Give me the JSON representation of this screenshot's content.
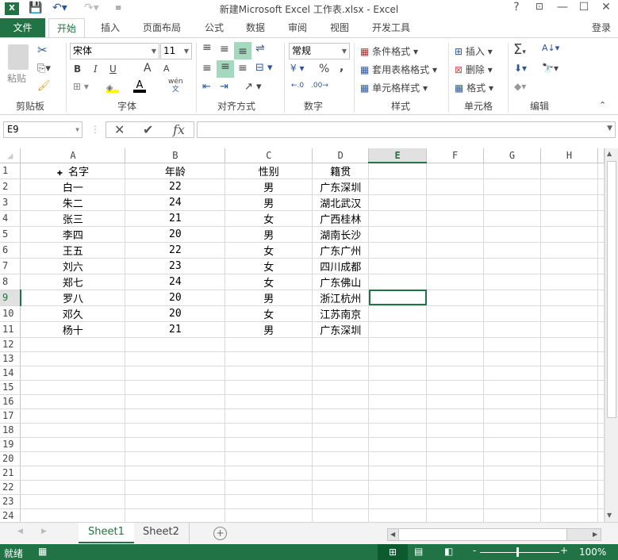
{
  "title": "新建Microsoft Excel 工作表.xlsx - Excel",
  "window_controls": {
    "help": "?",
    "restore_ribbon": "⊡",
    "minimize": "—",
    "maximize": "☐",
    "close": "✕"
  },
  "tabs": [
    "文件",
    "开始",
    "插入",
    "页面布局",
    "公式",
    "数据",
    "审阅",
    "视图",
    "开发工具"
  ],
  "login": "登录",
  "ribbon": {
    "clipboard": {
      "paste": "粘贴",
      "label": "剪贴板"
    },
    "font": {
      "name": "宋体",
      "size": "11",
      "bold": "B",
      "italic": "I",
      "underline": "U",
      "grow": "A",
      "shrink": "A",
      "wen": "wén",
      "wen2": "文",
      "label": "字体",
      "font_color": "#c00000",
      "fill_color": "#ffff00"
    },
    "alignment": {
      "label": "对齐方式"
    },
    "number": {
      "format": "常规",
      "percent": "%",
      "comma": ",",
      "label": "数字"
    },
    "styles": {
      "conditional": "条件格式",
      "table": "套用表格格式",
      "cell": "单元格样式",
      "label": "样式"
    },
    "cells": {
      "insert": "插入",
      "delete": "删除",
      "format": "格式",
      "label": "单元格"
    },
    "editing": {
      "label": "编辑"
    }
  },
  "formula_bar": {
    "name_box": "E9",
    "cancel": "✕",
    "enter": "✔",
    "fx": "fx",
    "value": ""
  },
  "columns": [
    "A",
    "B",
    "C",
    "D",
    "E",
    "F",
    "G",
    "H"
  ],
  "selected_col": "E",
  "selected_row": 9,
  "rows": [
    [
      "名字",
      "年龄",
      "性别",
      "籍贯"
    ],
    [
      "白一",
      "22",
      "男",
      "广东深圳"
    ],
    [
      "朱二",
      "24",
      "男",
      "湖北武汉"
    ],
    [
      "张三",
      "21",
      "女",
      "广西桂林"
    ],
    [
      "李四",
      "20",
      "男",
      "湖南长沙"
    ],
    [
      "王五",
      "22",
      "女",
      "广东广州"
    ],
    [
      "刘六",
      "23",
      "女",
      "四川成都"
    ],
    [
      "郑七",
      "24",
      "女",
      "广东佛山"
    ],
    [
      "罗八",
      "20",
      "男",
      "浙江杭州"
    ],
    [
      "邓久",
      "20",
      "女",
      "江苏南京"
    ],
    [
      "杨十",
      "21",
      "男",
      "广东深圳"
    ]
  ],
  "row_count": 25,
  "sheets": [
    "Sheet1",
    "Sheet2"
  ],
  "active_sheet": "Sheet1",
  "status": {
    "ready": "就绪",
    "zoom": "100%"
  },
  "accent": "#217346"
}
